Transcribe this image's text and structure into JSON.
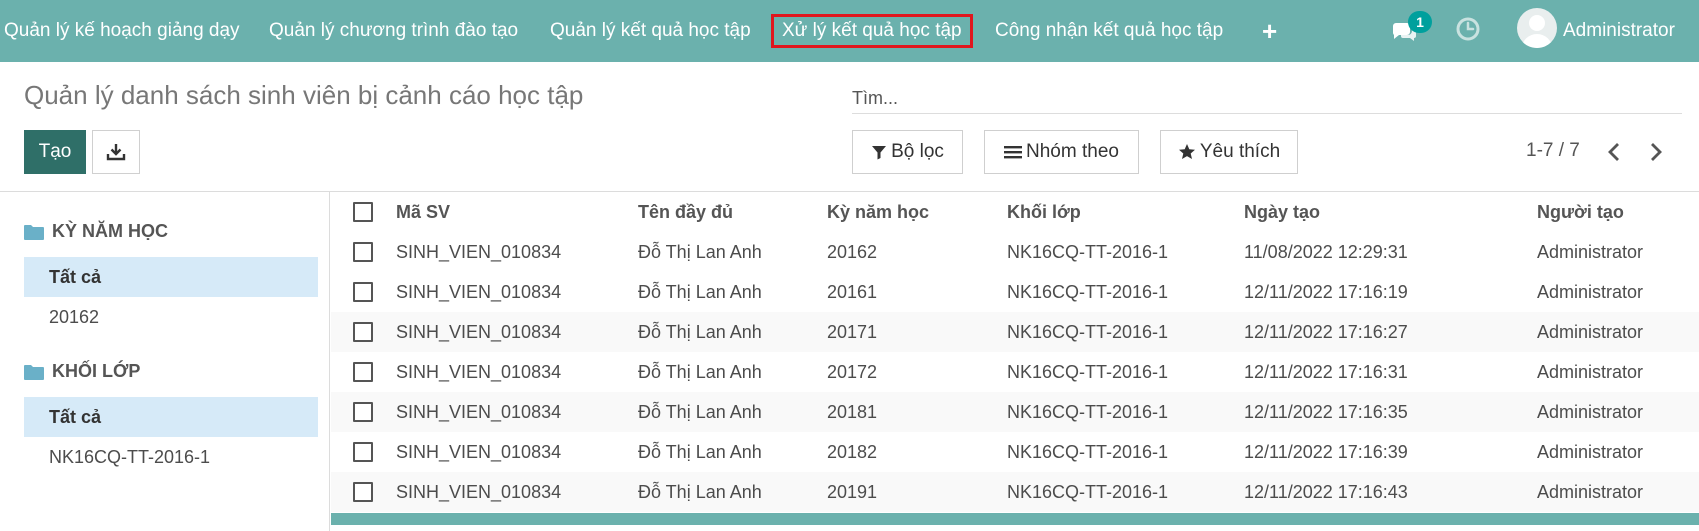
{
  "navbar": {
    "items": [
      {
        "label": "Quản lý kế hoạch giảng dạy"
      },
      {
        "label": "Quản lý chương trình đào tạo"
      },
      {
        "label": "Quản lý kết quả học tập"
      },
      {
        "label": "Xử lý kết quả học tập",
        "active": true
      },
      {
        "label": "Công nhận kết quả học tập"
      }
    ],
    "plus_label": "+",
    "chat_count": "1",
    "user_name": "Administrator",
    "brand_color": "#6bb1ad",
    "highlight_color": "#e0161e"
  },
  "page": {
    "title": "Quản lý danh sách sinh viên bị cảnh cáo học tập",
    "search_placeholder": "Tìm...",
    "create_label": "Tạo",
    "filter_label": "Bộ lọc",
    "group_label": "Nhóm theo",
    "favorite_label": "Yêu thích",
    "pager": "1-7 / 7"
  },
  "sidebar": {
    "sections": [
      {
        "title": "KỲ NĂM HỌC",
        "items": [
          {
            "label": "Tất cả",
            "active": true
          },
          {
            "label": "20162"
          }
        ]
      },
      {
        "title": "KHỐI LỚP",
        "items": [
          {
            "label": "Tất cả",
            "active": true
          },
          {
            "label": "NK16CQ-TT-2016-1"
          }
        ]
      }
    ]
  },
  "table": {
    "columns": [
      "Mã SV",
      "Tên đầy đủ",
      "Kỳ năm học",
      "Khối lớp",
      "Ngày tạo",
      "Người tạo"
    ],
    "rows": [
      {
        "masv": "SINH_VIEN_010834",
        "name": "Đỗ Thị Lan Anh",
        "ky": "20162",
        "khoi": "NK16CQ-TT-2016-1",
        "ngay": "11/08/2022 12:29:31",
        "nguoi": "Administrator"
      },
      {
        "masv": "SINH_VIEN_010834",
        "name": "Đỗ Thị Lan Anh",
        "ky": "20161",
        "khoi": "NK16CQ-TT-2016-1",
        "ngay": "12/11/2022 17:16:19",
        "nguoi": "Administrator"
      },
      {
        "masv": "SINH_VIEN_010834",
        "name": "Đỗ Thị Lan Anh",
        "ky": "20171",
        "khoi": "NK16CQ-TT-2016-1",
        "ngay": "12/11/2022 17:16:27",
        "nguoi": "Administrator"
      },
      {
        "masv": "SINH_VIEN_010834",
        "name": "Đỗ Thị Lan Anh",
        "ky": "20172",
        "khoi": "NK16CQ-TT-2016-1",
        "ngay": "12/11/2022 17:16:31",
        "nguoi": "Administrator"
      },
      {
        "masv": "SINH_VIEN_010834",
        "name": "Đỗ Thị Lan Anh",
        "ky": "20181",
        "khoi": "NK16CQ-TT-2016-1",
        "ngay": "12/11/2022 17:16:35",
        "nguoi": "Administrator"
      },
      {
        "masv": "SINH_VIEN_010834",
        "name": "Đỗ Thị Lan Anh",
        "ky": "20182",
        "khoi": "NK16CQ-TT-2016-1",
        "ngay": "12/11/2022 17:16:39",
        "nguoi": "Administrator"
      },
      {
        "masv": "SINH_VIEN_010834",
        "name": "Đỗ Thị Lan Anh",
        "ky": "20191",
        "khoi": "NK16CQ-TT-2016-1",
        "ngay": "12/11/2022 17:16:43",
        "nguoi": "Administrator"
      }
    ]
  }
}
